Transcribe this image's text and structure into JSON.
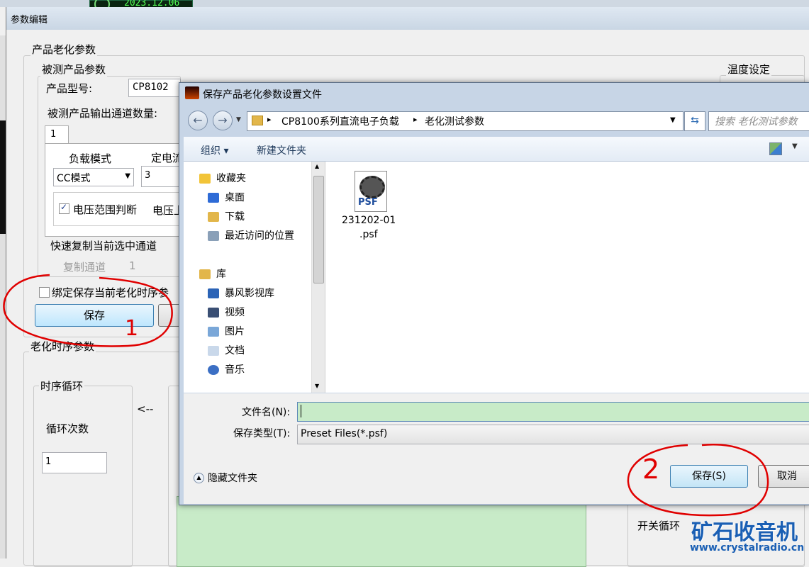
{
  "taskbar": {
    "clock_text": "2023.12.06"
  },
  "main_window": {
    "title": "参数编辑",
    "group_product_aging": "产品老化参数",
    "group_tested_product": "被测产品参数",
    "product_model_label": "产品型号:",
    "product_model_value": "CP8102",
    "channel_count_label": "被测产品输出通道数量:",
    "channel_tab": "1",
    "load_mode_label": "负载模式",
    "load_mode_value": "CC模式",
    "const_label": "定电流",
    "const_value": "3",
    "voltage_range_label": "电压范围判断",
    "voltage_upper_label": "电压上",
    "quick_copy_label": "快速复制当前选中通道",
    "copy_channel_label": "复制通道",
    "copy_channel_value": "1",
    "bind_save_label": "绑定保存当前老化时序参",
    "save_button": "保存",
    "group_aging_sequence": "老化时序参数",
    "sequence_loop_label": "时序循环",
    "arrow_text": "<--",
    "loop_count_label": "循环次数",
    "loop_count_value": "1",
    "temperature_label": "温度设定",
    "switch_loop_label": "开关循环"
  },
  "annotations": {
    "mark_1": "1",
    "mark_2": "2"
  },
  "dialog": {
    "title": "保存产品老化参数设置文件",
    "breadcrumb_1": "CP8100系列直流电子负载",
    "breadcrumb_2": "老化测试参数",
    "search_placeholder": "搜索 老化测试参数",
    "organize": "组织",
    "new_folder": "新建文件夹",
    "nav": {
      "favorites": "收藏夹",
      "desktop": "桌面",
      "downloads": "下载",
      "recent": "最近访问的位置",
      "libraries": "库",
      "baofeng": "暴风影视库",
      "videos": "视频",
      "pictures": "图片",
      "documents": "文档",
      "music": "音乐"
    },
    "file_icon_label": "PSF",
    "file_name_line1": "231202-01",
    "file_name_line2": ".psf",
    "filename_label": "文件名(N):",
    "filename_value": "",
    "filetype_label": "保存类型(T):",
    "filetype_value": "Preset Files(*.psf)",
    "hide_folders": "隐藏文件夹",
    "save_button": "保存(S)",
    "cancel_button": "取消"
  },
  "watermark": {
    "text_cn": "矿石收音机",
    "url": "www.crystalradio.cn"
  },
  "colors": {
    "green_fill": "#c8ebc8",
    "annotation_red": "#e00000",
    "watermark_blue": "#1a5fb4"
  }
}
